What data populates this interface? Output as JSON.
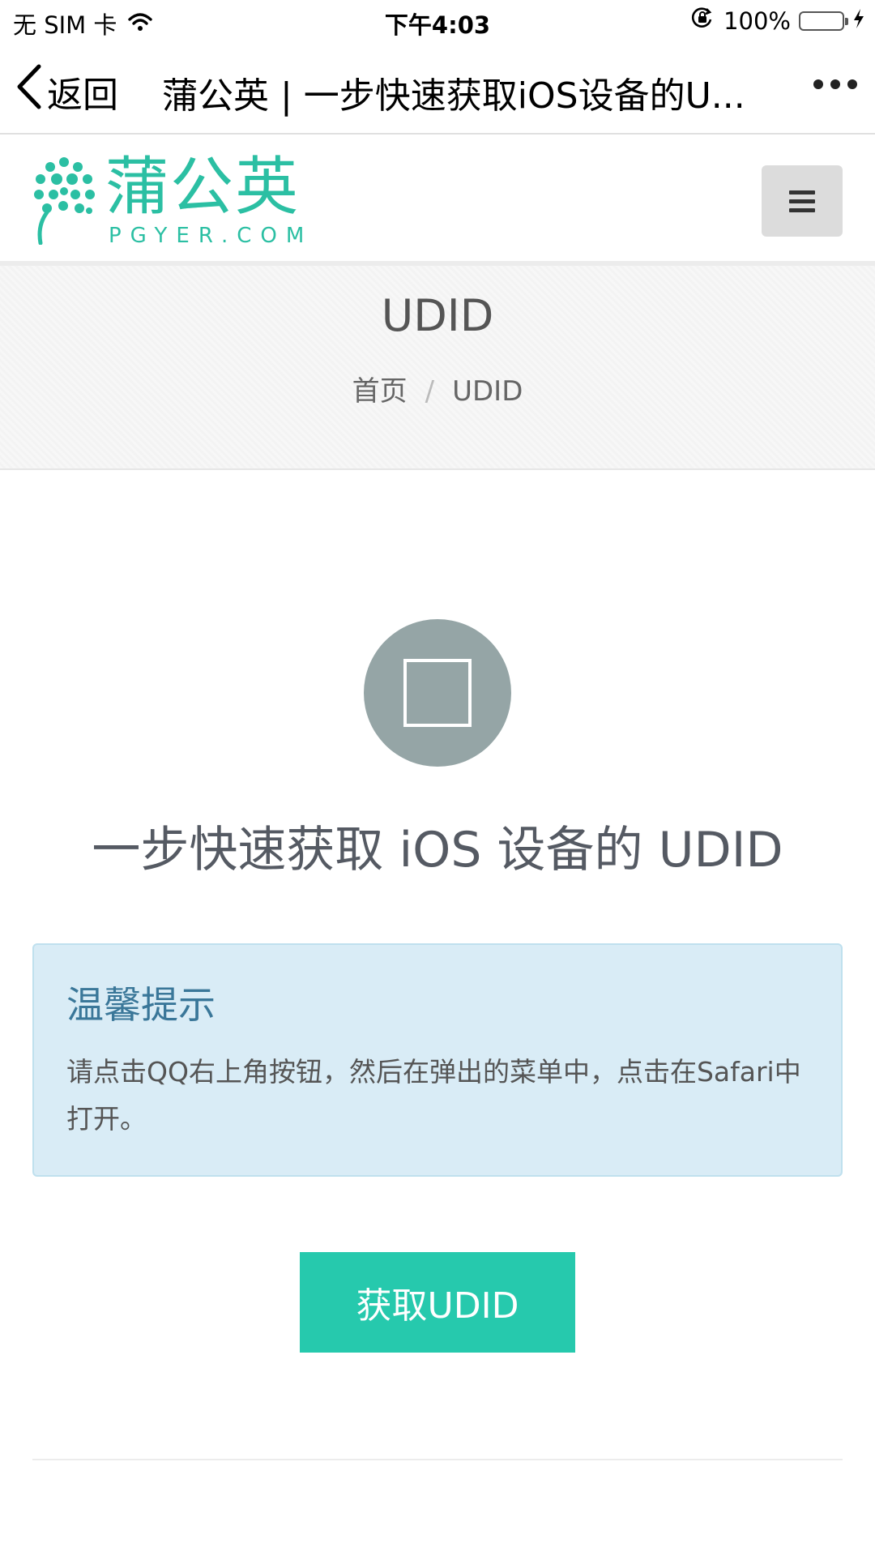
{
  "status_bar": {
    "carrier": "无 SIM 卡",
    "time": "下午4:03",
    "battery": "100%",
    "battery_level": 1.0
  },
  "nav_bar": {
    "back_label": "返回",
    "title": "蒲公英 | 一步快速获取iOS设备的U..."
  },
  "header": {
    "logo_cn": "蒲公英",
    "logo_en": "PGYER.COM",
    "brand_color": "#2bbfa3"
  },
  "banner": {
    "title": "UDID",
    "breadcrumb_home": "首页",
    "breadcrumb_separator": "/",
    "breadcrumb_current": "UDID"
  },
  "main": {
    "headline": "一步快速获取 iOS 设备的 UDID",
    "notice_title": "温馨提示",
    "notice_body": "请点击QQ右上角按钮，然后在弹出的菜单中，点击在Safari中打开。",
    "button_label": "获取UDID",
    "button_color": "#26c9ad"
  }
}
